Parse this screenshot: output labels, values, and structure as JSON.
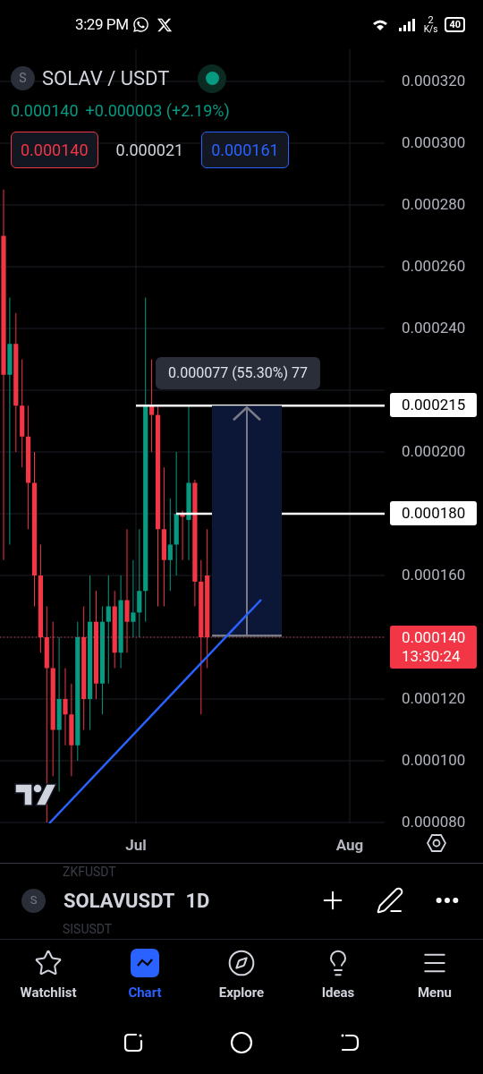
{
  "status_bar": {
    "time": "3:29 PM",
    "speed_value": "2",
    "speed_unit": "K/s",
    "battery": "40"
  },
  "symbol": {
    "logo_letter": "S",
    "title": "SOLAV / USDT",
    "last_price": "0.000140",
    "change": "+0.000003 (+2.19%)"
  },
  "trade_buttons": [
    {
      "kind": "sell",
      "label": "0.000140"
    },
    {
      "kind": "spread",
      "label": "0.000021"
    },
    {
      "kind": "buy",
      "label": "0.000161"
    }
  ],
  "price_axis": [
    "0.000320",
    "0.000300",
    "0.000280",
    "0.000260",
    "0.000240",
    "0.000200",
    "0.000160",
    "0.000120",
    "0.000100",
    "0.000080"
  ],
  "measure": {
    "label": "0.000077 (55.30%) 77"
  },
  "price_lines": [
    {
      "label": "0.000215"
    },
    {
      "label": "0.000180"
    }
  ],
  "current_price": {
    "price": "0.000140",
    "countdown": "13:30:24"
  },
  "time_axis": [
    "Jul",
    "Aug"
  ],
  "symbol_bar": {
    "previous": "ZKFUSDT",
    "logo_letter": "S",
    "symbol": "SOLAVUSDT",
    "interval": "1D",
    "next": "SISUSDT"
  },
  "nav": [
    {
      "kind": "watchlist",
      "label": "Watchlist",
      "selected": false
    },
    {
      "kind": "chart",
      "label": "Chart",
      "selected": true
    },
    {
      "kind": "explore",
      "label": "Explore",
      "selected": false
    },
    {
      "kind": "ideas",
      "label": "Ideas",
      "selected": false
    },
    {
      "kind": "menu",
      "label": "Menu",
      "selected": false
    }
  ]
}
